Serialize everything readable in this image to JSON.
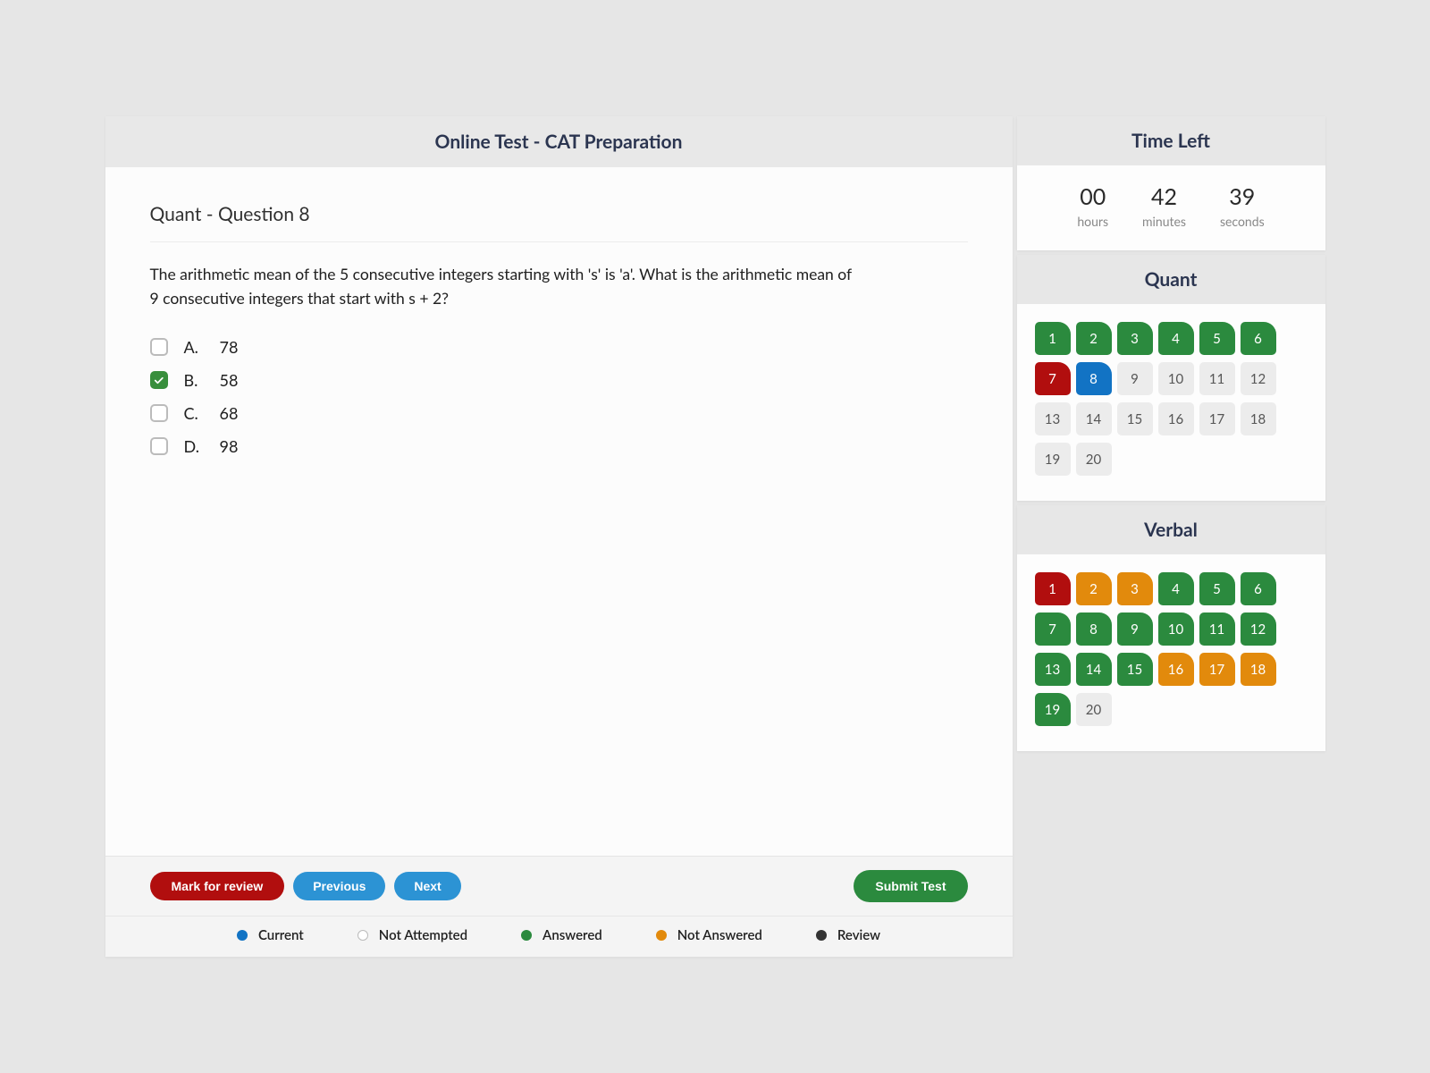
{
  "header": {
    "title": "Online Test - CAT Preparation"
  },
  "question": {
    "title": "Quant - Question 8",
    "text": "The arithmetic mean of the 5 consecutive integers starting with 's' is 'a'. What is the arithmetic mean of 9 consecutive integers that start with s + 2?",
    "options": [
      {
        "letter": "A.",
        "text": "78",
        "checked": false
      },
      {
        "letter": "B.",
        "text": "58",
        "checked": true
      },
      {
        "letter": "C.",
        "text": "68",
        "checked": false
      },
      {
        "letter": "D.",
        "text": "98",
        "checked": false
      }
    ]
  },
  "footer": {
    "mark_review": "Mark for review",
    "previous": "Previous",
    "next": "Next",
    "submit": "Submit Test"
  },
  "legend": {
    "current": "Current",
    "not_attempted": "Not Attempted",
    "answered": "Answered",
    "not_answered": "Not Answered",
    "review": "Review"
  },
  "time_left": {
    "title": "Time Left",
    "hours": "00",
    "hours_label": "hours",
    "minutes": "42",
    "minutes_label": "minutes",
    "seconds": "39",
    "seconds_label": "seconds"
  },
  "sections": [
    {
      "name": "Quant",
      "cells": [
        {
          "n": "1",
          "state": "answered"
        },
        {
          "n": "2",
          "state": "answered"
        },
        {
          "n": "3",
          "state": "answered"
        },
        {
          "n": "4",
          "state": "answered"
        },
        {
          "n": "5",
          "state": "answered"
        },
        {
          "n": "6",
          "state": "answered"
        },
        {
          "n": "7",
          "state": "reviewed"
        },
        {
          "n": "8",
          "state": "current"
        },
        {
          "n": "9",
          "state": "notattempted"
        },
        {
          "n": "10",
          "state": "notattempted"
        },
        {
          "n": "11",
          "state": "notattempted"
        },
        {
          "n": "12",
          "state": "notattempted"
        },
        {
          "n": "13",
          "state": "notattempted"
        },
        {
          "n": "14",
          "state": "notattempted"
        },
        {
          "n": "15",
          "state": "notattempted"
        },
        {
          "n": "16",
          "state": "notattempted"
        },
        {
          "n": "17",
          "state": "notattempted"
        },
        {
          "n": "18",
          "state": "notattempted"
        },
        {
          "n": "19",
          "state": "notattempted"
        },
        {
          "n": "20",
          "state": "notattempted"
        }
      ]
    },
    {
      "name": "Verbal",
      "cells": [
        {
          "n": "1",
          "state": "reviewed"
        },
        {
          "n": "2",
          "state": "notanswered"
        },
        {
          "n": "3",
          "state": "notanswered"
        },
        {
          "n": "4",
          "state": "answered"
        },
        {
          "n": "5",
          "state": "answered"
        },
        {
          "n": "6",
          "state": "answered"
        },
        {
          "n": "7",
          "state": "answered"
        },
        {
          "n": "8",
          "state": "answered"
        },
        {
          "n": "9",
          "state": "answered"
        },
        {
          "n": "10",
          "state": "answered"
        },
        {
          "n": "11",
          "state": "answered"
        },
        {
          "n": "12",
          "state": "answered"
        },
        {
          "n": "13",
          "state": "answered"
        },
        {
          "n": "14",
          "state": "answered"
        },
        {
          "n": "15",
          "state": "answered"
        },
        {
          "n": "16",
          "state": "notanswered"
        },
        {
          "n": "17",
          "state": "notanswered"
        },
        {
          "n": "18",
          "state": "notanswered"
        },
        {
          "n": "19",
          "state": "answered"
        },
        {
          "n": "20",
          "state": "notattempted"
        }
      ]
    }
  ]
}
